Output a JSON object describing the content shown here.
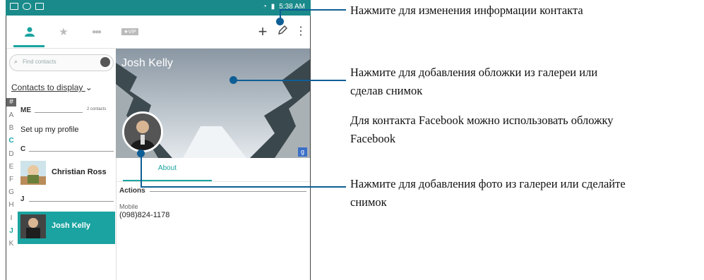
{
  "statusbar": {
    "time": "5:38 AM"
  },
  "toolbar": {
    "tabs": [
      "contacts-tab",
      "favorites-tab",
      "groups-tab",
      "vip-tab"
    ],
    "vip_label": "★VIP",
    "add_label": "+",
    "menu_label": "⋮"
  },
  "search": {
    "placeholder": "Find contacts"
  },
  "contacts_to_display": "Contacts to display",
  "alphabet": [
    "#",
    "A",
    "B",
    "C",
    "D",
    "E",
    "F",
    "G",
    "H",
    "I",
    "J",
    "K"
  ],
  "alphabet_active": [
    "C",
    "J"
  ],
  "sections": {
    "me": {
      "title": "ME",
      "count": "2 contacts",
      "setup": "Set up my profile"
    },
    "c": {
      "title": "C",
      "contact": "Christian Ross"
    },
    "j": {
      "title": "J",
      "contact": "Josh Kelly"
    }
  },
  "detail": {
    "name": "Josh Kelly",
    "tab_about": "About",
    "actions": "Actions",
    "mobile_label": "Mobile",
    "mobile_number": "(098)824-1178",
    "badge": "g"
  },
  "callouts": {
    "edit": "Нажмите для изменения информации контакта",
    "cover_1": "Нажмите для добавления обложки из галереи или",
    "cover_2": "сделав снимок",
    "facebook_1": "Для контакта Facebook можно использовать обложку",
    "facebook_2": "Facebook",
    "photo_1": "Нажмите для добавления фото из галереи или сделайте",
    "photo_2": "снимок"
  },
  "colors": {
    "accent": "#1aa3a0",
    "statusbar": "#1b8a8a",
    "callout_line": "#0e5e96"
  }
}
